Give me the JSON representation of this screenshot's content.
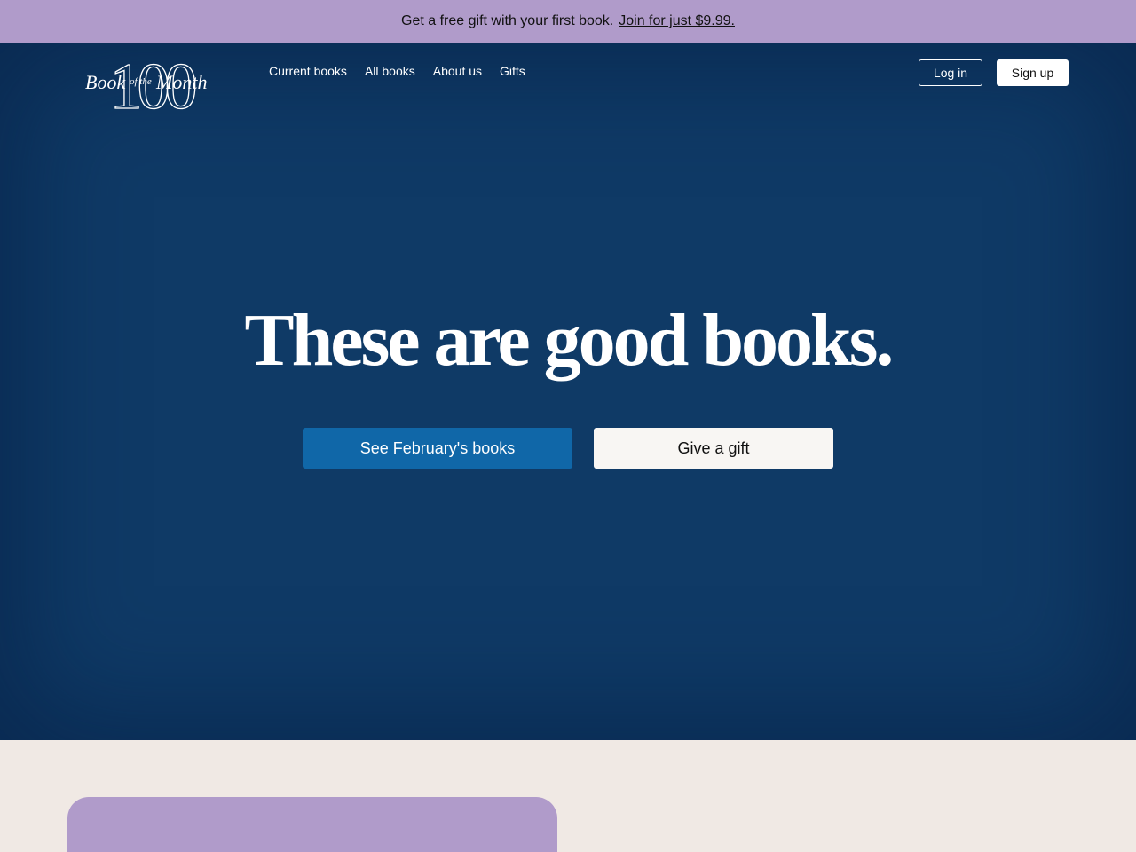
{
  "promo": {
    "text": "Get a free gift with your first book.",
    "link_label": "Join for just $9.99."
  },
  "header": {
    "logo": {
      "number": "100",
      "word_book": "Book",
      "word_of_the": "of the",
      "word_month": "Month"
    },
    "nav": [
      {
        "label": "Current books"
      },
      {
        "label": "All books"
      },
      {
        "label": "About us"
      },
      {
        "label": "Gifts"
      }
    ],
    "login_label": "Log in",
    "signup_label": "Sign up"
  },
  "hero": {
    "headline": "These are good books.",
    "primary_cta": "See February's books",
    "secondary_cta": "Give a gift"
  },
  "colors": {
    "promo_bg": "#b09bca",
    "hero_bg": "#0f3a66",
    "primary_button": "#1067a8",
    "page_bg": "#f0e9e4"
  }
}
